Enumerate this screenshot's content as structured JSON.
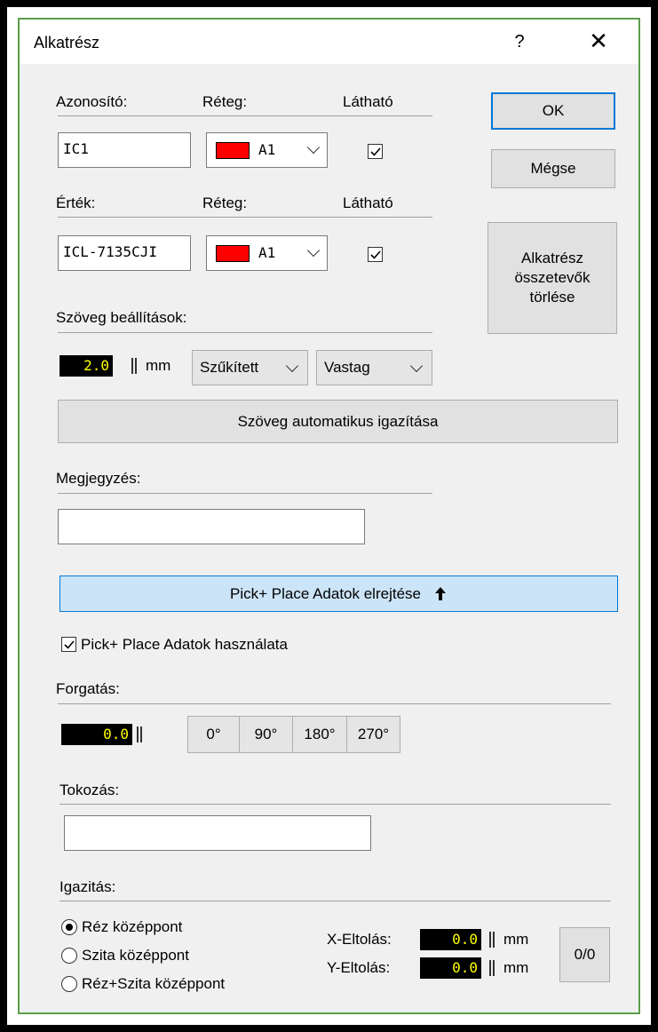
{
  "dialog": {
    "title": "Alkatrész",
    "help": "?",
    "close": "✕"
  },
  "header_row1": {
    "id_label": "Azonosító:",
    "layer_label": "Réteg:",
    "visible_label": "Látható"
  },
  "id_field": {
    "value": "IC1"
  },
  "id_layer": {
    "value": "A1",
    "color": "#ff0000"
  },
  "id_visible": {
    "checked": true
  },
  "header_row2": {
    "value_label": "Érték:",
    "layer_label": "Réteg:",
    "visible_label": "Látható"
  },
  "value_field": {
    "value": "ICL-7135CJI"
  },
  "value_layer": {
    "value": "A1",
    "color": "#ff0000"
  },
  "value_visible": {
    "checked": true
  },
  "buttons": {
    "ok": "OK",
    "cancel": "Mégse",
    "delete_parts": "Alkatrész összetevők törlése"
  },
  "text_settings": {
    "label": "Szöveg beállítások:",
    "size": "2.0",
    "unit": "mm",
    "width_option": "Szűkített",
    "weight_option": "Vastag",
    "auto_align": "Szöveg automatikus igazítása"
  },
  "note": {
    "label": "Megjegyzés:",
    "value": ""
  },
  "pick_place": {
    "hide_button": "Pick+ Place Adatok elrejtése",
    "use_label": "Pick+ Place Adatok használata",
    "use_checked": true
  },
  "rotation": {
    "label": "Forgatás:",
    "value": "0.0",
    "presets": [
      "0°",
      "90°",
      "180°",
      "270°"
    ]
  },
  "package": {
    "label": "Tokozás:",
    "value": ""
  },
  "alignment": {
    "label": "Igazitás:",
    "options": [
      "Réz középpont",
      "Szita középpont",
      "Réz+Szita középpont"
    ],
    "selected": 0,
    "x_label": "X-Eltolás:",
    "x_value": "0.0",
    "y_label": "Y-Eltolás:",
    "y_value": "0.0",
    "unit": "mm",
    "reset_button": "0/0"
  }
}
